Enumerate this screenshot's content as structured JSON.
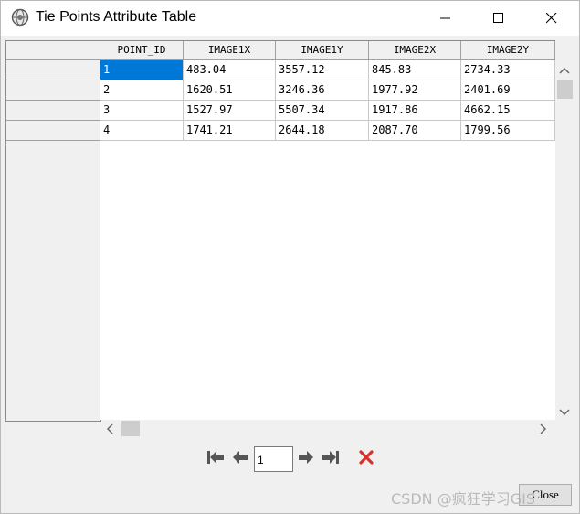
{
  "window": {
    "title": "Tie Points Attribute Table",
    "icon": "app-globe-icon"
  },
  "table": {
    "columns": [
      "POINT_ID",
      "IMAGE1X",
      "IMAGE1Y",
      "IMAGE2X",
      "IMAGE2Y"
    ],
    "rows": [
      [
        "1",
        "483.04",
        "3557.12",
        "845.83",
        "2734.33"
      ],
      [
        "2",
        "1620.51",
        "3246.36",
        "1977.92",
        "2401.69"
      ],
      [
        "3",
        "1527.97",
        "5507.34",
        "1917.86",
        "4662.15"
      ],
      [
        "4",
        "1741.21",
        "2644.18",
        "2087.70",
        "1799.56"
      ]
    ],
    "selected_cell": "1"
  },
  "navigation": {
    "page_value": "1",
    "buttons": [
      "first-page",
      "previous-page",
      "next-page",
      "last-page",
      "delete"
    ]
  },
  "footer": {
    "close_label": "Close",
    "watermark": "CSDN @疯狂学习GIS"
  },
  "colors": {
    "selection": "#0078d7",
    "delete_icon": "#d9302a",
    "nav_arrow": "#555555"
  }
}
